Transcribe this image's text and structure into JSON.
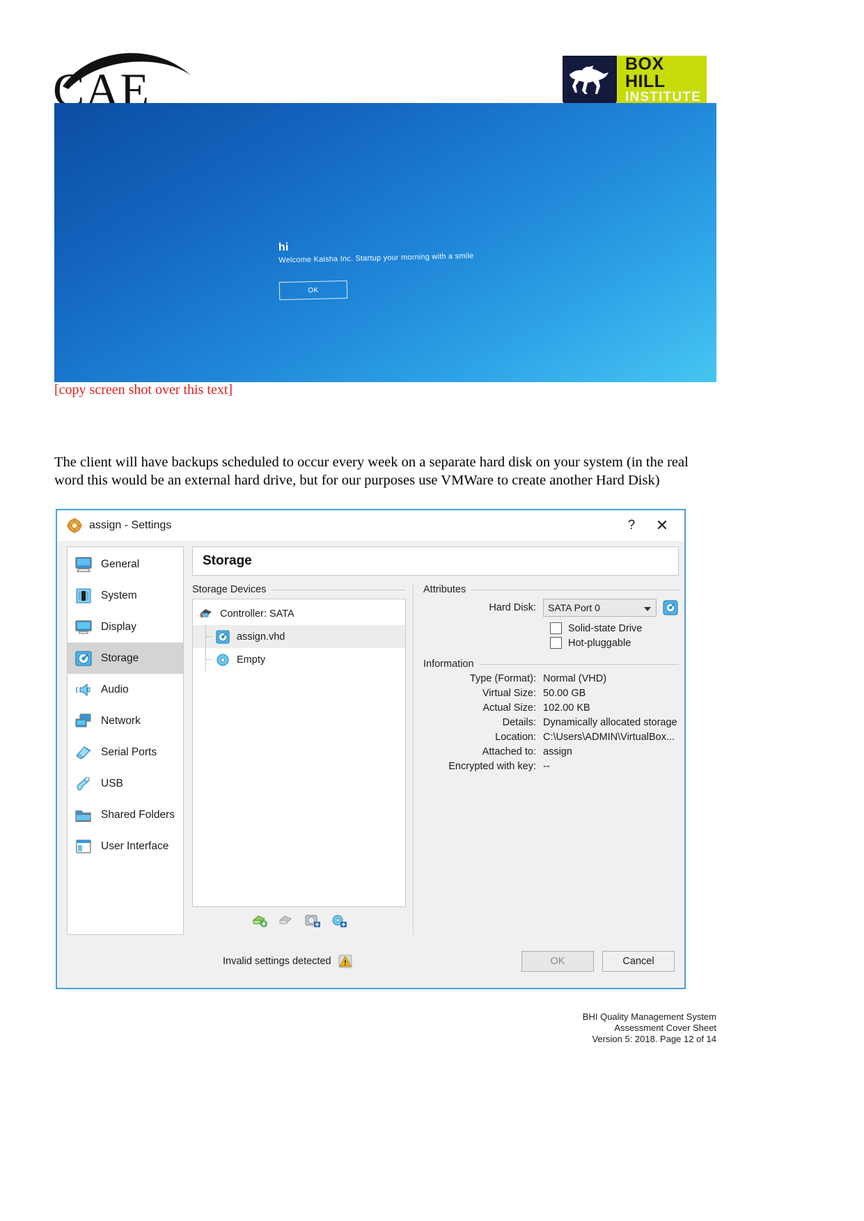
{
  "header": {
    "cae_logo_text": "CAE",
    "bhi_logo": {
      "line1": "BOX HILL",
      "line2": "INSTITUTE",
      "icon": "running-horse-icon",
      "shield_color": "#141a3c",
      "accent_color": "#c8dc0a"
    }
  },
  "screenshot_windows": {
    "greeting": "hi",
    "message": "Welcome Kaisha Inc. Startup your morning with a smile",
    "ok_label": "OK"
  },
  "red_note": "[copy screen shot over this text]",
  "paragraph": "The client will have backups scheduled to occur every week on a separate hard disk on your system (in the real word this would be an external hard drive, but for our purposes use VMWare to create another Hard Disk)",
  "dialog": {
    "title": "assign - Settings",
    "title_icon": "vbox-settings-gear-icon",
    "help_label": "?",
    "close_label": "✕",
    "sidebar": [
      {
        "label": "General",
        "icon": "monitor-icon",
        "selected": false
      },
      {
        "label": "System",
        "icon": "motherboard-icon",
        "selected": false
      },
      {
        "label": "Display",
        "icon": "display-icon",
        "selected": false
      },
      {
        "label": "Storage",
        "icon": "harddisk-icon",
        "selected": true
      },
      {
        "label": "Audio",
        "icon": "speaker-icon",
        "selected": false
      },
      {
        "label": "Network",
        "icon": "network-icon",
        "selected": false
      },
      {
        "label": "Serial Ports",
        "icon": "serial-port-icon",
        "selected": false
      },
      {
        "label": "USB",
        "icon": "usb-icon",
        "selected": false
      },
      {
        "label": "Shared Folders",
        "icon": "folder-icon",
        "selected": false
      },
      {
        "label": "User Interface",
        "icon": "user-interface-icon",
        "selected": false
      }
    ],
    "page_title": "Storage",
    "storage_devices": {
      "group_label": "Storage Devices",
      "tree": [
        {
          "label": "Controller: SATA",
          "icon": "sata-controller-icon",
          "level": 0,
          "selected": false
        },
        {
          "label": "assign.vhd",
          "icon": "hard-disk-icon",
          "level": 1,
          "selected": true
        },
        {
          "label": "Empty",
          "icon": "optical-disk-icon",
          "level": 1,
          "selected": false
        }
      ],
      "toolbar": [
        {
          "name": "add-attachment-icon"
        },
        {
          "name": "remove-attachment-icon"
        },
        {
          "name": "add-hard-disk-icon"
        },
        {
          "name": "add-optical-drive-icon"
        }
      ]
    },
    "attributes": {
      "group_label": "Attributes",
      "hard_disk_label": "Hard Disk:",
      "hard_disk_value": "SATA Port 0",
      "choose_disk_icon": "choose-virtual-hard-disk-icon",
      "checkboxes": [
        {
          "label": "Solid-state Drive",
          "checked": false
        },
        {
          "label": "Hot-pluggable",
          "checked": false
        }
      ]
    },
    "information": {
      "group_label": "Information",
      "rows": [
        {
          "label": "Type (Format):",
          "value": "Normal (VHD)"
        },
        {
          "label": "Virtual Size:",
          "value": "50.00 GB"
        },
        {
          "label": "Actual Size:",
          "value": "102.00 KB"
        },
        {
          "label": "Details:",
          "value": "Dynamically allocated storage"
        },
        {
          "label": "Location:",
          "value": "C:\\Users\\ADMIN\\VirtualBox..."
        },
        {
          "label": "Attached to:",
          "value": "assign"
        },
        {
          "label": "Encrypted with key:",
          "value": "--"
        }
      ]
    },
    "footer": {
      "invalid_message": "Invalid settings detected",
      "warning_icon": "warning-triangle-icon",
      "ok_label": "OK",
      "cancel_label": "Cancel"
    }
  },
  "page_footer": {
    "line1": "BHI Quality Management System",
    "line2": "Assessment Cover Sheet",
    "line3": "Version 5: 2018. Page 12 of 14"
  }
}
